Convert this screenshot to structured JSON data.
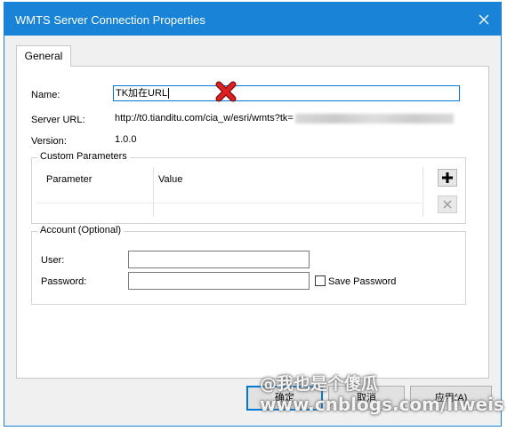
{
  "window": {
    "title": "WMTS Server Connection Properties"
  },
  "tabs": [
    {
      "label": "General"
    }
  ],
  "general": {
    "name_label": "Name:",
    "name_value": "TK加在URL",
    "server_url_label": "Server URL:",
    "server_url_value": "http://t0.tianditu.com/cia_w/esri/wmts?tk=",
    "version_label": "Version:",
    "version_value": "1.0.0"
  },
  "custom_parameters": {
    "title": "Custom Parameters",
    "columns": [
      "Parameter",
      "Value"
    ]
  },
  "account": {
    "title": "Account (Optional)",
    "user_label": "User:",
    "password_label": "Password:",
    "save_password_label": "Save Password",
    "save_password_checked": false
  },
  "buttons": {
    "ok": "确定",
    "cancel": "取消",
    "apply": "应用(A)"
  },
  "watermark": {
    "line1": "@我也是个傻瓜",
    "line2": "www.cnblogs.com/liweis"
  },
  "colors": {
    "titlebar": "#1883d7",
    "focus": "#0078d7",
    "x_mark": "#e02020"
  }
}
